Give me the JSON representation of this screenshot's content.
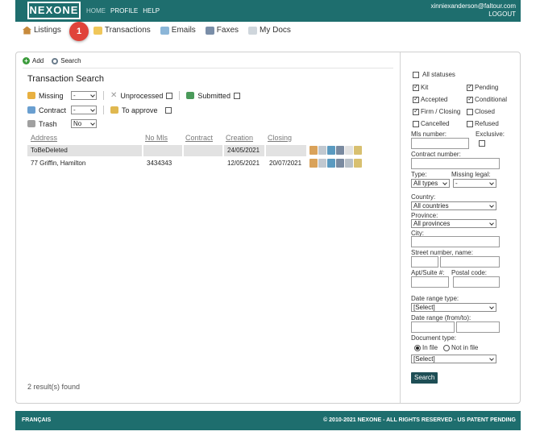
{
  "header": {
    "logo": "NEXONE",
    "nav": [
      "HOME",
      "PROFILE",
      "HELP"
    ],
    "user_email": "xinniexanderson@faltour.com",
    "logout": "LOGOUT"
  },
  "tabs": [
    "Listings",
    "Transactions",
    "Emails",
    "Faxes",
    "My Docs"
  ],
  "annotation_badge": "1",
  "toolbar": {
    "add": "Add",
    "search": "Search"
  },
  "search": {
    "title": "Transaction Search",
    "missing_label": "Missing",
    "missing_value": "-",
    "unprocessed_label": "Unprocessed",
    "submitted_label": "Submitted",
    "contract_label": "Contract",
    "contract_value": "-",
    "to_approve_label": "To approve",
    "trash_label": "Trash",
    "trash_value": "No"
  },
  "table": {
    "columns": [
      "Address",
      "No Mls",
      "Contract",
      "Creation",
      "Closing"
    ],
    "rows": [
      {
        "address": "ToBeDeleted",
        "mls": "",
        "contract": "",
        "creation": "24/05/2021",
        "closing": ""
      },
      {
        "address": "77 Griffin, Hamilton",
        "mls": "3434343",
        "contract": "",
        "creation": "12/05/2021",
        "closing": "20/07/2021"
      }
    ]
  },
  "results": "2 result(s) found",
  "sidebar": {
    "all_statuses": "All statuses",
    "statuses": [
      {
        "label": "Kit",
        "checked": true
      },
      {
        "label": "Pending",
        "checked": true
      },
      {
        "label": "Accepted",
        "checked": true
      },
      {
        "label": "Conditional",
        "checked": true
      },
      {
        "label": "Firm / Closing",
        "checked": true
      },
      {
        "label": "Closed",
        "checked": false
      },
      {
        "label": "Cancelled",
        "checked": false
      },
      {
        "label": "Refused",
        "checked": false
      }
    ],
    "mls_number": "Mls number:",
    "exclusive": "Exclusive:",
    "contract_number": "Contract number:",
    "type": "Type:",
    "type_value": "All types",
    "missing_legal": "Missing legal:",
    "missing_legal_value": "-",
    "country": "Country:",
    "country_value": "All countries",
    "province": "Province:",
    "province_value": "All provinces",
    "city": "City:",
    "street": "Street number, name:",
    "apt": "Apt/Suite #:",
    "postal": "Postal code:",
    "date_range_type": "Date range type:",
    "date_range_type_value": "[Select]",
    "date_range": "Date range (from/to):",
    "document_type": "Document type:",
    "in_file": "In file",
    "not_in_file": "Not in file",
    "document_type_value": "[Select]",
    "search_button": "Search"
  },
  "footer": {
    "lang": "FRANÇAIS",
    "copyright": "© 2010-2021 NEXONE - ALL RIGHTS RESERVED - US PATENT PENDING"
  }
}
